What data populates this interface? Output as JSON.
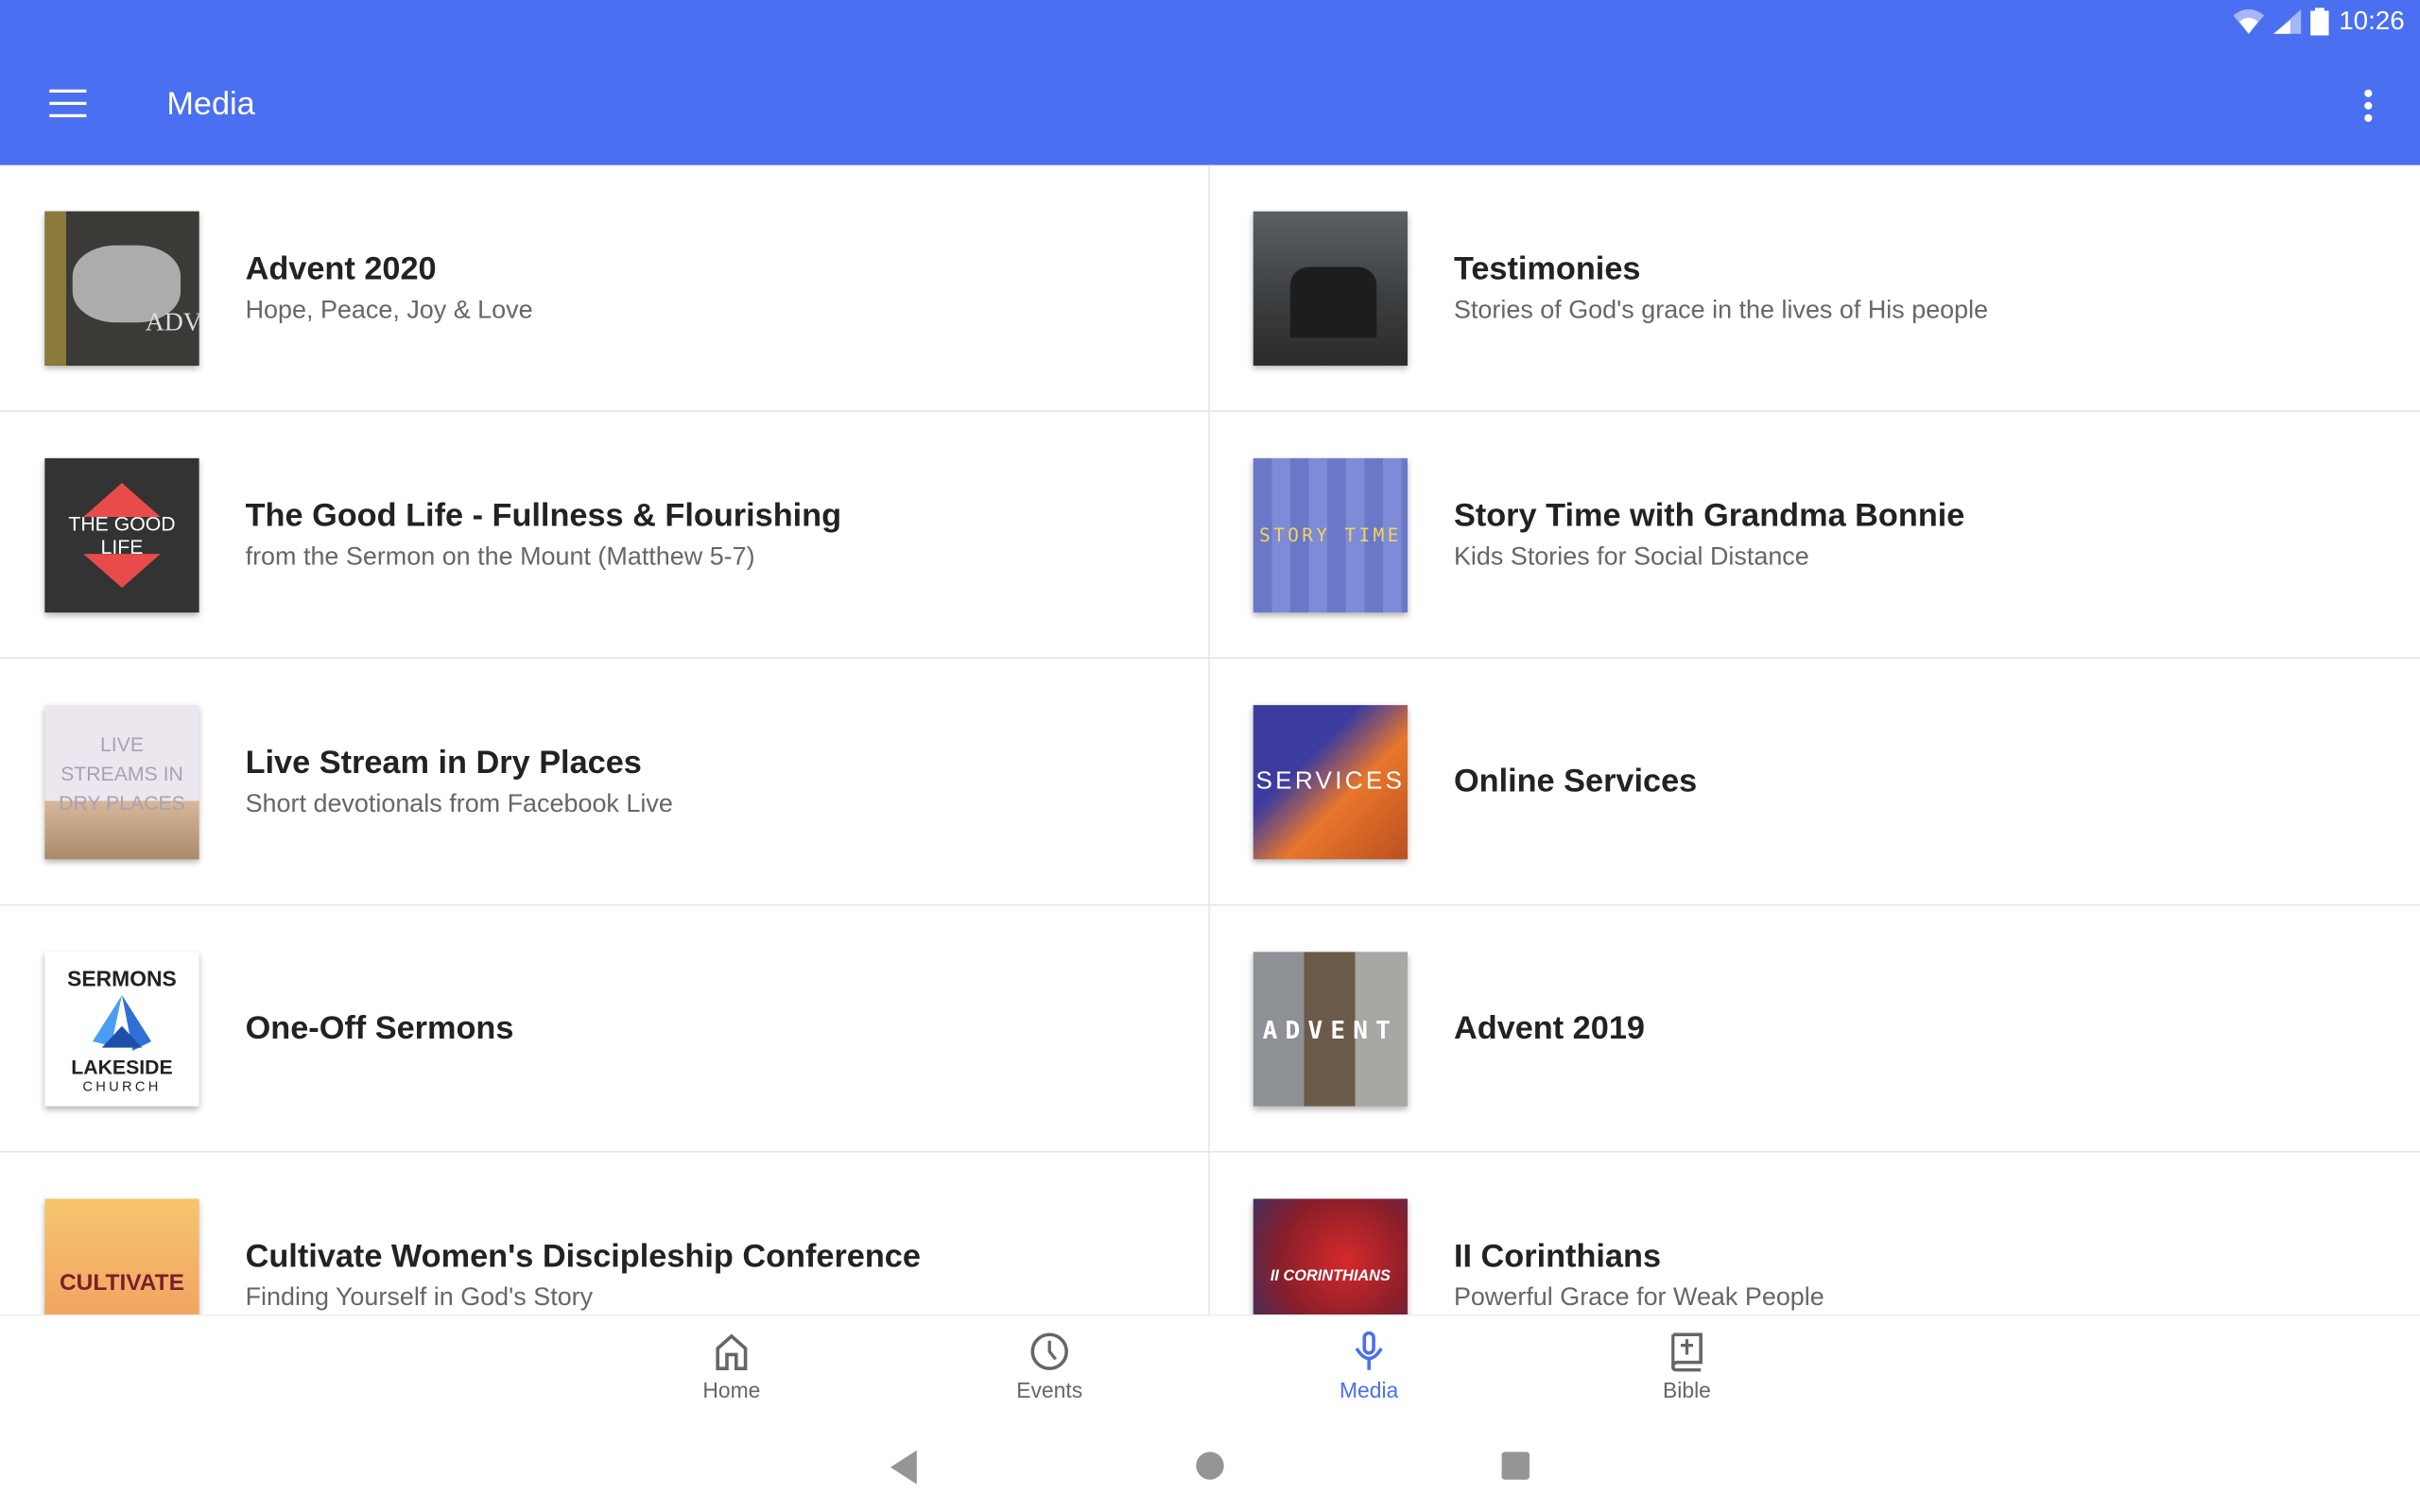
{
  "status_bar": {
    "time": "10:26",
    "icons": [
      "wifi-icon",
      "cell-signal-icon",
      "battery-icon"
    ]
  },
  "app_bar": {
    "title": "Media",
    "menu_icon": "hamburger-menu-icon",
    "overflow_icon": "more-vert-icon"
  },
  "accent": "#4a6ff0",
  "items": [
    {
      "title": "Advent 2020",
      "subtitle": "Hope, Peace, Joy & Love",
      "thumb_text": "ADV"
    },
    {
      "title": "Testimonies",
      "subtitle": "Stories of God's grace in the lives of His people",
      "thumb_text": ""
    },
    {
      "title": "The Good Life - Fullness & Flourishing",
      "subtitle": "from the Sermon on the Mount (Matthew 5-7)",
      "thumb_text": "THE GOOD LIFE"
    },
    {
      "title": "Story Time with Grandma Bonnie",
      "subtitle": "Kids Stories for Social Distance",
      "thumb_text": "STORY TIME"
    },
    {
      "title": "Live Stream in Dry Places",
      "subtitle": "Short devotionals from Facebook Live",
      "thumb_text": "LIVE STREAMS IN DRY PLACES"
    },
    {
      "title": "Online Services",
      "subtitle": "",
      "thumb_text": "SERVICES"
    },
    {
      "title": "One-Off Sermons",
      "subtitle": "",
      "thumb_text": "SERMONS",
      "thumb_text2": "LAKESIDE",
      "thumb_text3": "CHURCH"
    },
    {
      "title": "Advent 2019",
      "subtitle": "",
      "thumb_text": "ADVENT"
    },
    {
      "title": "Cultivate Women's Discipleship Conference",
      "subtitle": "Finding Yourself in God's Story",
      "thumb_text": "CULTIVATE"
    },
    {
      "title": "II Corinthians",
      "subtitle": "Powerful Grace for Weak People",
      "thumb_text": "II CORINTHIANS"
    }
  ],
  "bottom_nav": [
    {
      "label": "Home",
      "icon": "home-icon",
      "active": false
    },
    {
      "label": "Events",
      "icon": "clock-icon",
      "active": false
    },
    {
      "label": "Media",
      "icon": "microphone-icon",
      "active": true
    },
    {
      "label": "Bible",
      "icon": "bible-icon",
      "active": false
    }
  ]
}
